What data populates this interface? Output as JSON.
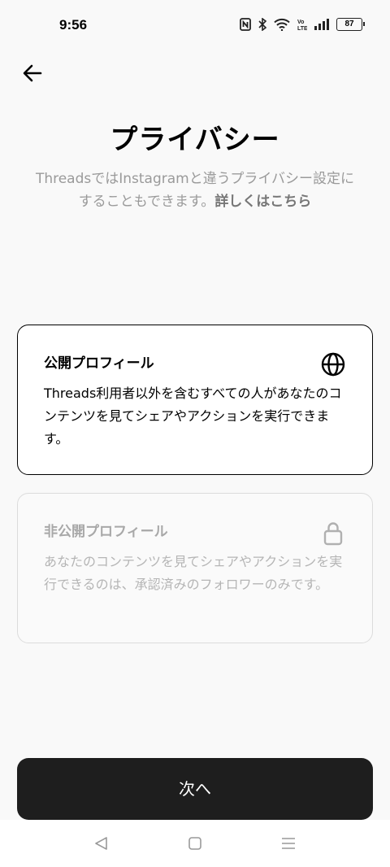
{
  "status_bar": {
    "time": "9:56",
    "battery": "87"
  },
  "header": {
    "title": "プライバシー"
  },
  "description": {
    "text": "ThreadsではInstagramと違うプライバシー設定にすることもできます。",
    "link": "詳しくはこちら"
  },
  "options": [
    {
      "title": "公開プロフィール",
      "body": "Threads利用者以外を含むすべての人があなたのコンテンツを見てシェアやアクションを実行できます。",
      "icon": "globe-icon",
      "selected": true
    },
    {
      "title": "非公開プロフィール",
      "body": "あなたのコンテンツを見てシェアやアクションを実行できるのは、承認済みのフォロワーのみです。",
      "icon": "lock-icon",
      "selected": false
    }
  ],
  "next_button": {
    "label": "次へ"
  }
}
